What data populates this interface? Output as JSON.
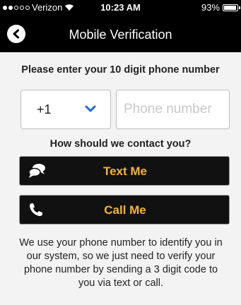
{
  "status_bar": {
    "carrier": "Verizon",
    "time": "10:23 AM",
    "battery_percent": "93%",
    "battery_level": 0.93,
    "signal_dots": [
      true,
      true,
      false,
      false,
      false
    ]
  },
  "nav": {
    "title": "Mobile Verification",
    "back_icon": "back-chevron-circle-icon"
  },
  "form": {
    "prompt": "Please enter your 10 digit phone number",
    "country_code": "+1",
    "country_code_icon": "chevron-down-icon",
    "phone_placeholder": "Phone number",
    "contact_question": "How should we contact you?"
  },
  "buttons": {
    "text_label": "Text Me",
    "text_icon": "chat-bubbles-icon",
    "call_label": "Call Me",
    "call_icon": "phone-handset-icon"
  },
  "info": "We use your phone number to identify you in our system, so we just need to verify your phone number by sending a 3 digit code to you via text or call.",
  "colors": {
    "bar_background": "#000000",
    "button_label": "#f6b52f",
    "chevron": "#1a6fd8",
    "page_background": "#f3f3f3"
  }
}
